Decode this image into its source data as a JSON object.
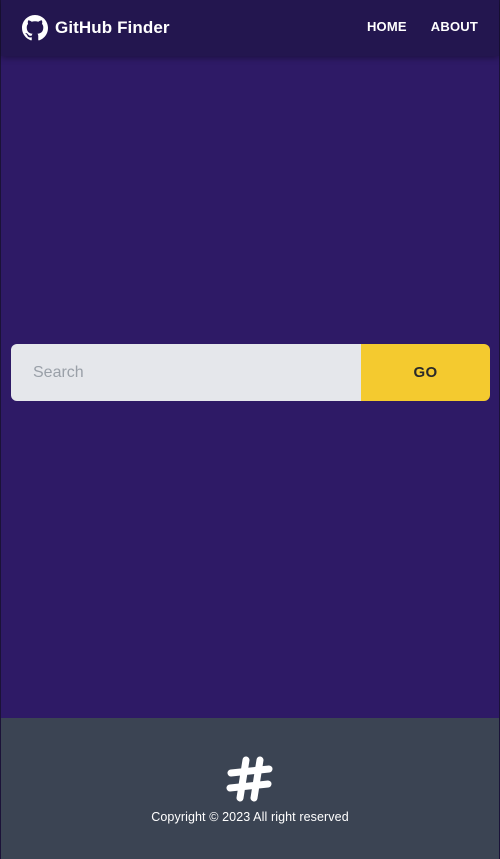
{
  "navbar": {
    "brand_icon": "github-icon",
    "title": "GitHub Finder",
    "links": [
      {
        "label": "HOME"
      },
      {
        "label": "ABOUT"
      }
    ]
  },
  "search": {
    "placeholder": "Search",
    "value": "",
    "button_label": "GO"
  },
  "footer": {
    "icon": "hashtag-icon",
    "copyright": "Copyright © 2023 All right reserved"
  },
  "colors": {
    "navbar_bg": "#23164f",
    "main_bg": "#2e1a66",
    "input_bg": "#e5e7eb",
    "button_bg": "#f4ca2f",
    "footer_bg": "#3b4453"
  }
}
